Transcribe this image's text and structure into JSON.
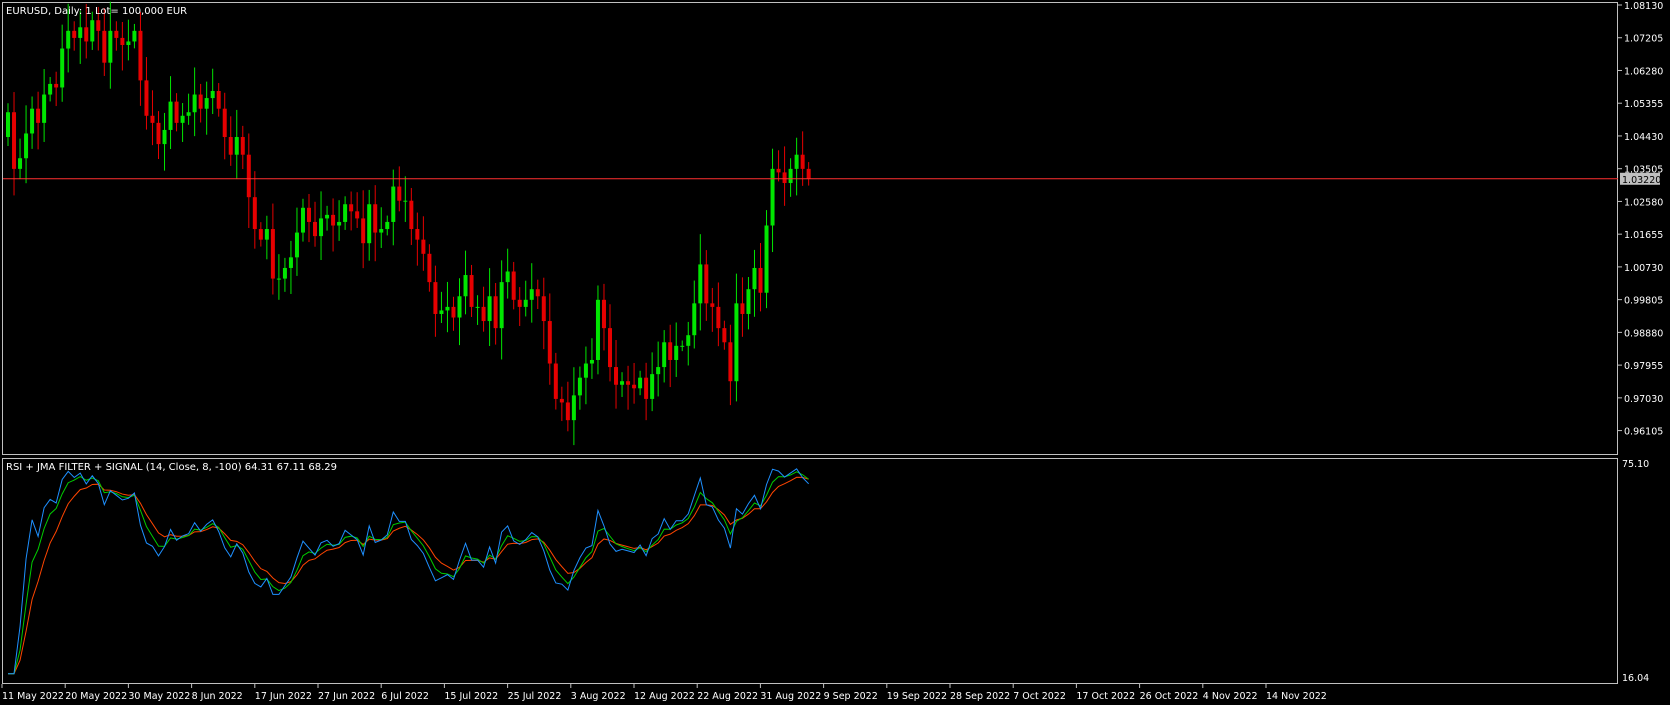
{
  "price_panel": {
    "title": "EURUSD, Daily:  1 Lot= 100,000 EUR",
    "current_price_label": "1.03220"
  },
  "indicator_panel": {
    "title": "RSI + JMA FILTER + SIGNAL (14, Close, 8, -100) 64.31 67.11 68.29",
    "top_label": "75.10",
    "bottom_label": "16.04"
  },
  "colors": {
    "background": "#000000",
    "bull": "#00e600",
    "bear": "#e60000",
    "price_line": "#ff3030",
    "rsi": "#1e90ff",
    "jma": "#00cc00",
    "signal": "#ff4500",
    "frame": "#c0c0c0"
  },
  "chart_data": [
    {
      "type": "candlestick",
      "title": "EURUSD, Daily:  1 Lot= 100,000 EUR",
      "ylim": [
        0.955,
        1.0813
      ],
      "y_ticks": [
        "1.08130",
        "1.07205",
        "1.06280",
        "1.05355",
        "1.04430",
        "1.03505",
        "1.02580",
        "1.01655",
        "1.00730",
        "0.99805",
        "0.98880",
        "0.97955",
        "0.97030",
        "0.96105"
      ],
      "x_ticks": [
        "11 May 2022",
        "20 May 2022",
        "30 May 2022",
        "8 Jun 2022",
        "17 Jun 2022",
        "27 Jun 2022",
        "6 Jul 2022",
        "15 Jul 2022",
        "25 Jul 2022",
        "3 Aug 2022",
        "12 Aug 2022",
        "22 Aug 2022",
        "31 Aug 2022",
        "9 Sep 2022",
        "19 Sep 2022",
        "28 Sep 2022",
        "7 Oct 2022",
        "17 Oct 2022",
        "26 Oct 2022",
        "4 Nov 2022",
        "14 Nov 2022"
      ],
      "current_price": 1.0322,
      "closes": [
        1.051,
        1.035,
        1.038,
        1.045,
        1.052,
        1.048,
        1.056,
        1.059,
        1.058,
        1.069,
        1.074,
        1.072,
        1.075,
        1.071,
        1.077,
        1.074,
        1.065,
        1.074,
        1.072,
        1.07,
        1.071,
        1.074,
        1.06,
        1.05,
        1.048,
        1.042,
        1.046,
        1.054,
        1.048,
        1.05,
        1.051,
        1.056,
        1.052,
        1.055,
        1.057,
        1.052,
        1.044,
        1.039,
        1.044,
        1.039,
        1.027,
        1.018,
        1.015,
        1.018,
        1.004,
        1.004,
        1.007,
        1.01,
        1.017,
        1.024,
        1.02,
        1.016,
        1.021,
        1.022,
        1.019,
        1.02,
        1.025,
        1.023,
        1.021,
        1.014,
        1.025,
        1.017,
        1.018,
        1.02,
        1.03,
        1.026,
        1.026,
        1.018,
        1.015,
        1.011,
        1.003,
        0.994,
        0.995,
        0.996,
        0.993,
        0.999,
        1.005,
        0.996,
        0.996,
        0.992,
        0.999,
        0.99,
        1.003,
        1.006,
        0.998,
        0.996,
        0.998,
        1.001,
        0.999,
        0.992,
        0.98,
        0.97,
        0.969,
        0.964,
        0.971,
        0.976,
        0.98,
        0.981,
        0.998,
        0.99,
        0.979,
        0.974,
        0.975,
        0.974,
        0.973,
        0.976,
        0.97,
        0.977,
        0.979,
        0.986,
        0.981,
        0.985,
        0.985,
        0.988,
        0.997,
        1.008,
        0.997,
        0.996,
        0.99,
        0.986,
        0.975,
        0.997,
        0.994,
        1.001,
        1.007,
        1.0,
        1.019,
        1.035,
        1.034,
        1.031,
        1.035,
        1.039,
        1.035,
        1.0322
      ],
      "series": [
        {
          "name": "RSI"
        },
        {
          "name": "JMA FILTER"
        },
        {
          "name": "SIGNAL"
        }
      ]
    },
    {
      "type": "line",
      "title": "RSI + JMA FILTER + SIGNAL (14, Close, 8, -100) 64.31 67.11 68.29",
      "ylim": [
        16.04,
        75.1
      ],
      "series": [
        {
          "name": "RSI",
          "last": 64.31
        },
        {
          "name": "JMA FILTER",
          "last": 67.11
        },
        {
          "name": "SIGNAL",
          "last": 68.29
        }
      ]
    }
  ]
}
